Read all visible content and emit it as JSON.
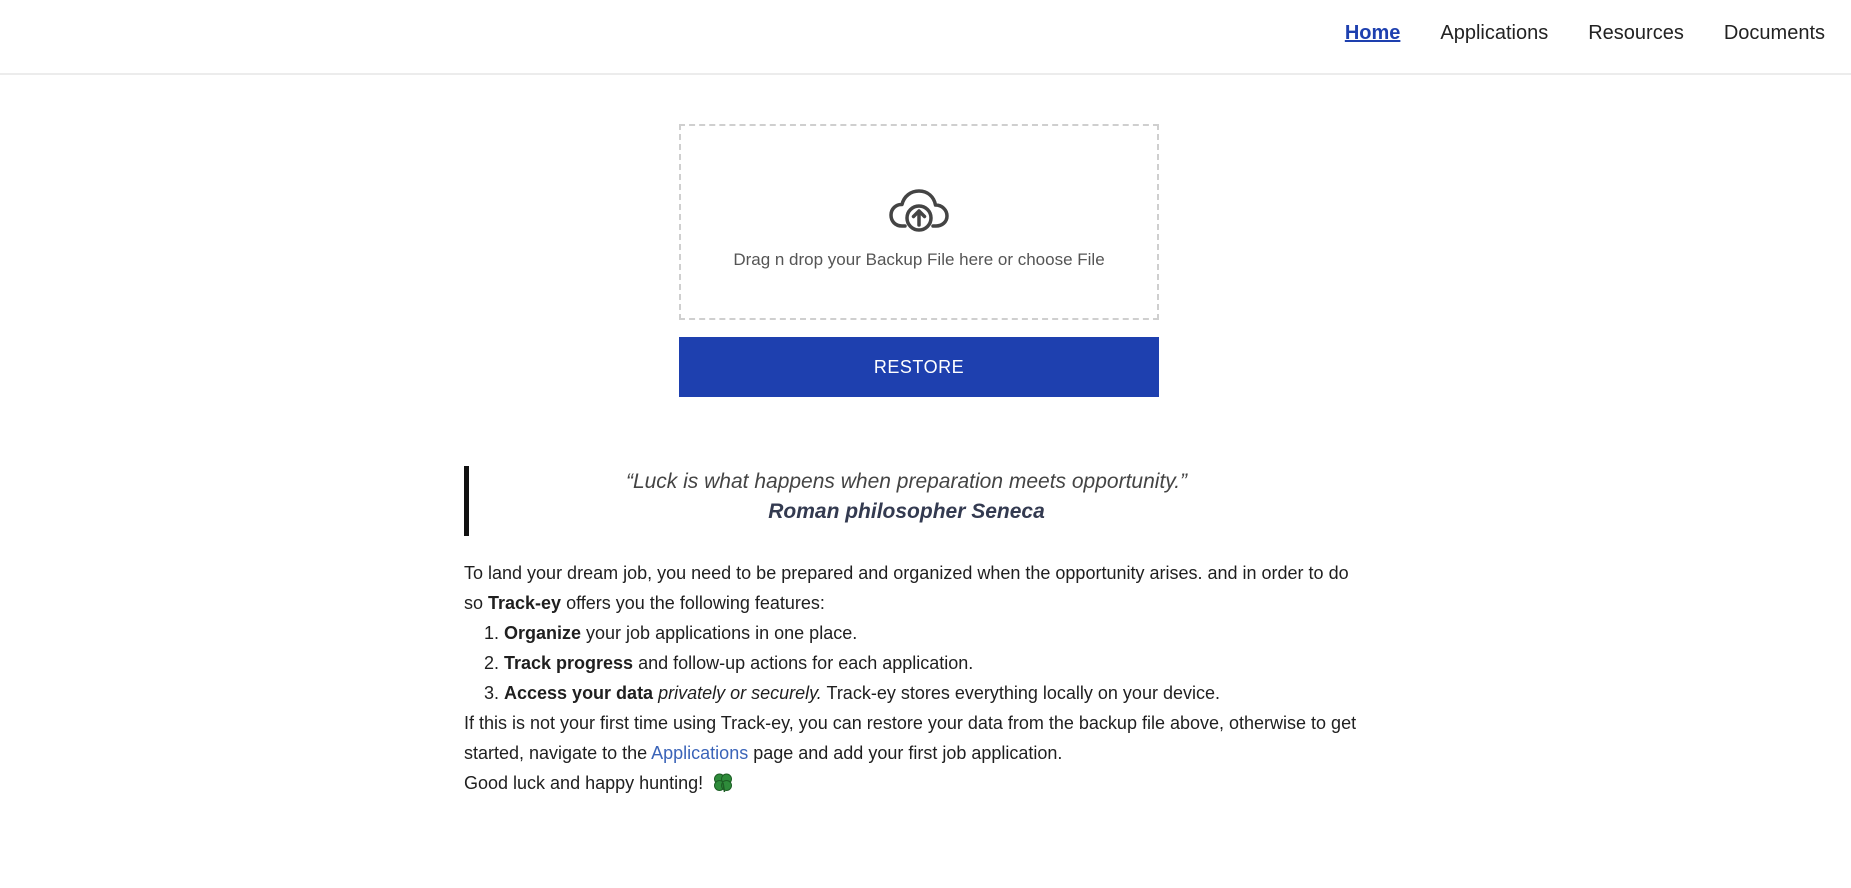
{
  "nav": {
    "items": [
      {
        "label": "Home",
        "active": true
      },
      {
        "label": "Applications"
      },
      {
        "label": "Resources"
      },
      {
        "label": "Documents"
      }
    ]
  },
  "upload": {
    "icon": "cloud-upload-icon",
    "text": "Drag n drop your Backup File here or choose File",
    "button_label": "RESTORE",
    "button_color": "#1e40af"
  },
  "quote": {
    "text": "“Luck is what happens when preparation meets opportunity.”",
    "author": "Roman philosopher Seneca"
  },
  "intro": {
    "line1": "To land your dream job, you need to be prepared and organized when the opportunity arises. and in order to do so ",
    "brand": "Track-ey",
    "line1_end": " offers you the following features:"
  },
  "features": [
    {
      "bold": "Organize",
      "rest": " your job applications in one place."
    },
    {
      "bold": "Track progress",
      "rest": " and follow-up actions for each application."
    },
    {
      "bold": "Access your data",
      "italic": " privately or securely.",
      "rest": " Track-ey stores everything locally on your device."
    }
  ],
  "outro": {
    "line1": "If this is not your first time using Track-ey, you can restore your data from the backup file above, otherwise to get started, navigate to the ",
    "link": "Applications",
    "line1_end": " page and add your first job application.",
    "line2": "Good luck and happy hunting! ",
    "emoji_icon": "four-leaf-clover-icon"
  }
}
